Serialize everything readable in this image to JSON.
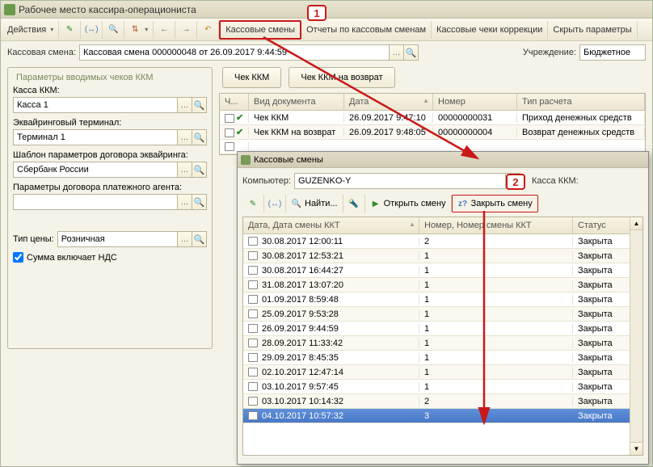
{
  "window": {
    "title": "Рабочее место кассира-операциониста",
    "icon": "cashier-app-icon"
  },
  "toolbar": {
    "actions_label": "Действия",
    "tabs": [
      "Кассовые смены",
      "Отчеты по кассовым сменам",
      "Кассовые чеки коррекции",
      "Скрыть параметры"
    ]
  },
  "form": {
    "session_label": "Кассовая смена:",
    "session_value": "Кассовая смена 000000048 от 26.09.2017 9:44:59",
    "institution_label": "Учреждение:",
    "institution_value": "Бюджетное"
  },
  "callouts": {
    "one": "1",
    "two": "2"
  },
  "params": {
    "legend": "Параметры вводимых чеков ККМ",
    "kassa_label": "Касса ККМ:",
    "kassa_value": "Касса 1",
    "acquiring_label": "Эквайринговый терминал:",
    "acquiring_value": "Терминал 1",
    "template_label": "Шаблон параметров договора эквайринга:",
    "template_value": "Сбербанк России",
    "agent_label": "Параметры договора платежного агента:",
    "agent_value": "",
    "price_label": "Тип цены:",
    "price_value": "Розничная",
    "vat_checkbox": "Сумма включает НДС"
  },
  "right": {
    "btn_receipt": "Чек ККМ",
    "btn_return": "Чек ККМ на возврат"
  },
  "main_grid": {
    "headers": {
      "mark": "Ч...",
      "type": "Вид документа",
      "date": "Дата",
      "num": "Номер",
      "calc": "Тип расчета"
    },
    "col_widths": {
      "mark": 36,
      "type": 118,
      "date": 110,
      "num": 104,
      "calc": 160
    },
    "rows": [
      {
        "type": "Чек ККМ",
        "date": "26.09.2017 9:47:10",
        "num": "00000000031",
        "calc": "Приход денежных средств"
      },
      {
        "type": "Чек ККМ на возврат",
        "date": "26.09.2017 9:48:05",
        "num": "00000000004",
        "calc": "Возврат денежных средств"
      }
    ]
  },
  "modal": {
    "title": "Кассовые смены",
    "computer_label": "Компьютер:",
    "computer_value": "GUZENKO-Y",
    "kassa_label": "Касса ККМ:",
    "tb": {
      "find": "Найти...",
      "open": "Открыть смену",
      "close": "Закрыть смену"
    },
    "grid": {
      "headers": {
        "date": "Дата, Дата смены ККТ",
        "num": "Номер, Номер смены ККТ",
        "status": "Статус"
      },
      "col_widths": {
        "date": 218,
        "num": 190,
        "status": 80
      },
      "rows": [
        {
          "date": "30.08.2017 12:00:11",
          "num": "2",
          "status": "Закрыта"
        },
        {
          "date": "30.08.2017 12:53:21",
          "num": "1",
          "status": "Закрыта"
        },
        {
          "date": "30.08.2017 16:44:27",
          "num": "1",
          "status": "Закрыта"
        },
        {
          "date": "31.08.2017 13:07:20",
          "num": "1",
          "status": "Закрыта"
        },
        {
          "date": "01.09.2017 8:59:48",
          "num": "1",
          "status": "Закрыта"
        },
        {
          "date": "25.09.2017 9:53:28",
          "num": "1",
          "status": "Закрыта"
        },
        {
          "date": "26.09.2017 9:44:59",
          "num": "1",
          "status": "Закрыта"
        },
        {
          "date": "28.09.2017 11:33:42",
          "num": "1",
          "status": "Закрыта"
        },
        {
          "date": "29.09.2017 8:45:35",
          "num": "1",
          "status": "Закрыта"
        },
        {
          "date": "02.10.2017 12:47:14",
          "num": "1",
          "status": "Закрыта"
        },
        {
          "date": "03.10.2017 9:57:45",
          "num": "1",
          "status": "Закрыта"
        },
        {
          "date": "03.10.2017 10:14:32",
          "num": "2",
          "status": "Закрыта"
        },
        {
          "date": "04.10.2017 10:57:32",
          "num": "3",
          "status": "Закрыта",
          "selected": true
        }
      ]
    }
  }
}
